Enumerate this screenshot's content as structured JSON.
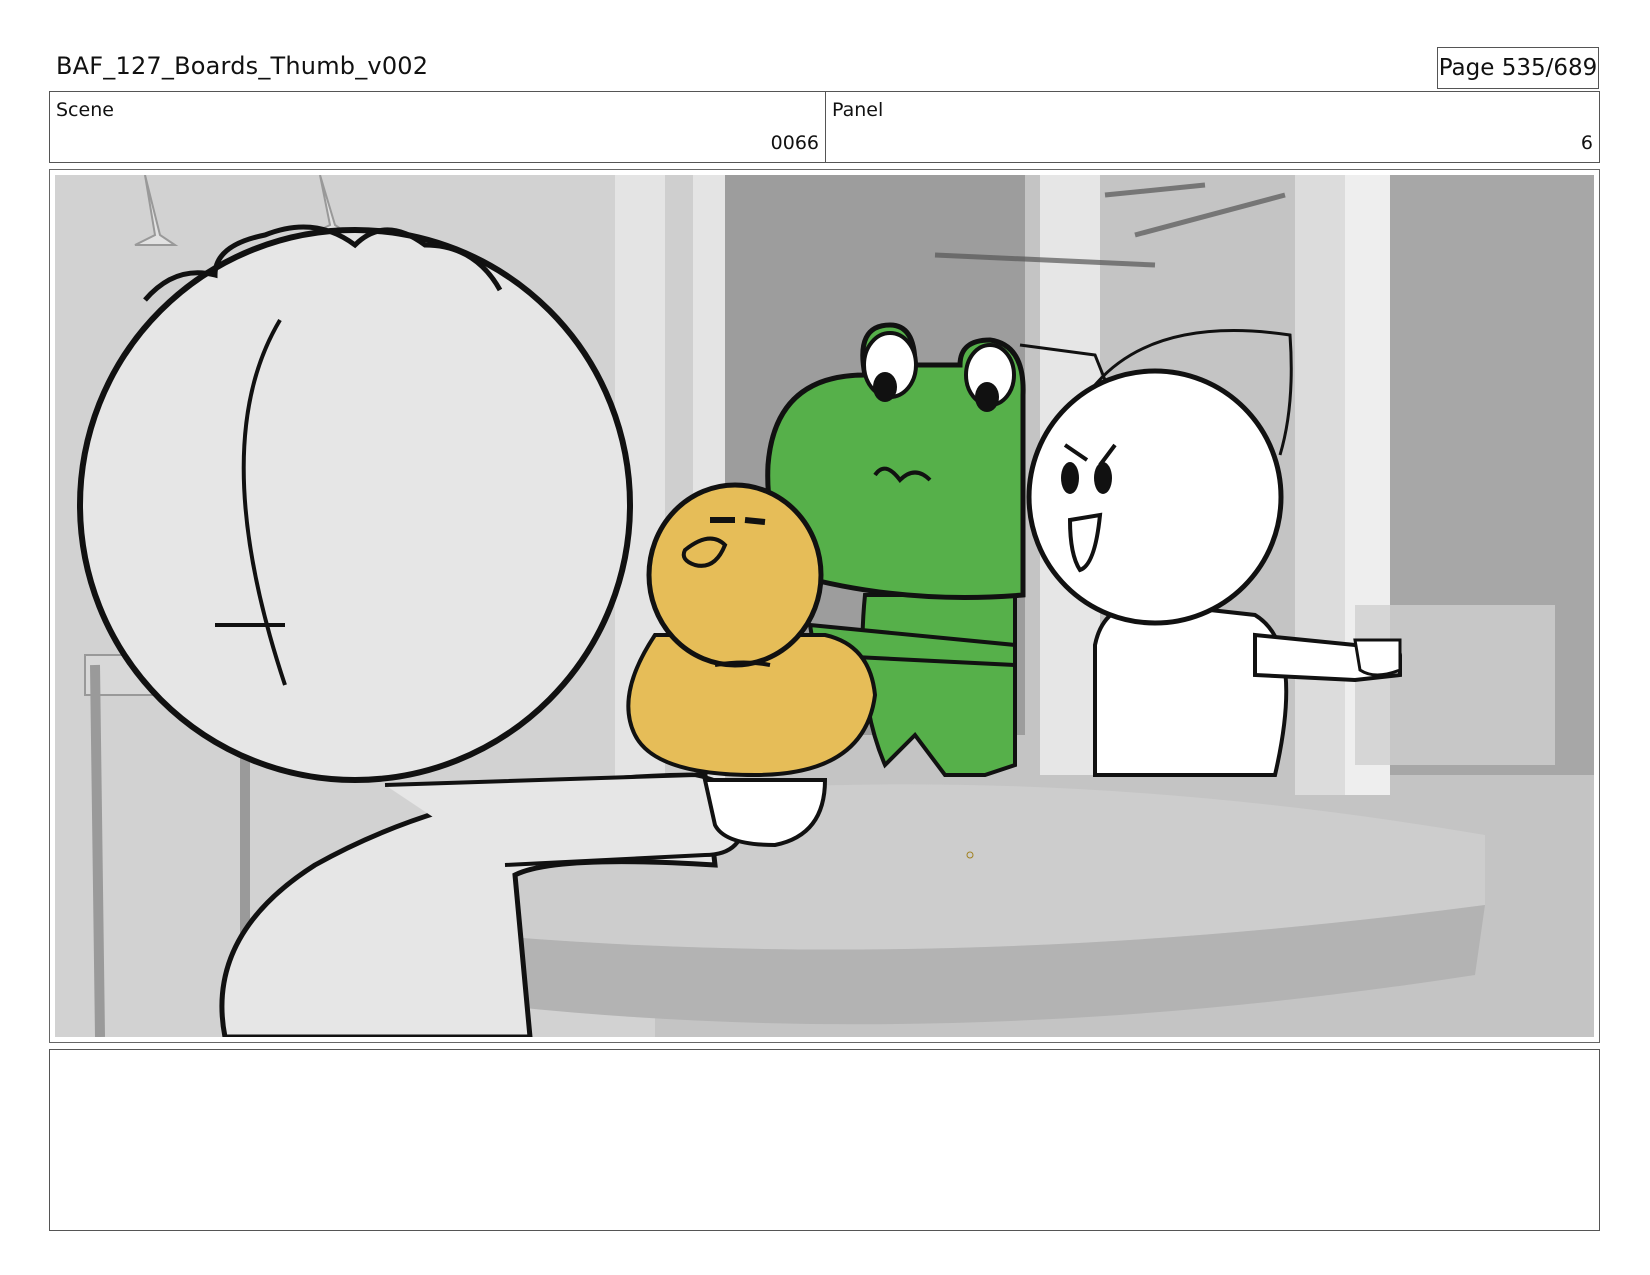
{
  "header": {
    "title": "BAF_127_Boards_Thumb_v002",
    "page_label": "Page 535/689"
  },
  "info": {
    "scene_label": "Scene",
    "scene_value": "0066",
    "panel_label": "Panel",
    "panel_value": "6"
  },
  "notes": {
    "text": ""
  },
  "colors": {
    "frog_green": "#56b04a",
    "duck_yellow": "#e6bd58",
    "line_black": "#111111",
    "bg_gray": "#bcbcbc"
  }
}
